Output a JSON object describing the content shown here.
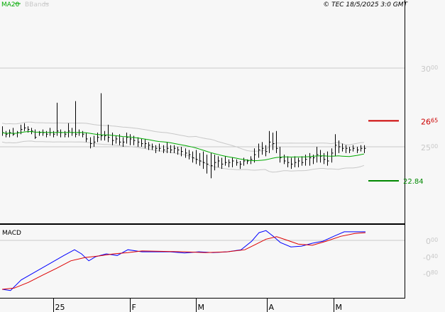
{
  "header": {
    "legend_ma": "MA20",
    "legend_bb": "BBands",
    "copyright": "© TEC 18/5/2025 3:0 GMT"
  },
  "colors": {
    "ma": "#00aa00",
    "bb": "#c8c8c8",
    "macd": "#0000ff",
    "signal": "#dd0000",
    "resistance": "#cc0000",
    "support": "#008800"
  },
  "chart_data": [
    {
      "type": "ohlc",
      "title": "Price",
      "ylim": [
        20.5,
        31.5
      ],
      "yticks": [
        {
          "value": 30,
          "int": "30",
          "dec": "00"
        },
        {
          "value": 25,
          "int": "25",
          "dec": "00"
        }
      ],
      "xticks": [
        {
          "bar": 14,
          "label": "25"
        },
        {
          "bar": 35,
          "label": "F"
        },
        {
          "bar": 53,
          "label": "M"
        },
        {
          "bar": 72.5,
          "label": "A"
        },
        {
          "bar": 90.7,
          "label": "M"
        }
      ],
      "levels": [
        {
          "name": "resistance",
          "value": 26.65,
          "int": "26",
          "dec": "65"
        },
        {
          "name": "support",
          "value": 22.84,
          "label": "22.84"
        }
      ],
      "overlays": [
        "MA20",
        "BBands(20,2)"
      ],
      "bars_hlc": [
        [
          26.3,
          25.7,
          25.9
        ],
        [
          26.0,
          25.6,
          25.8
        ],
        [
          26.1,
          25.6,
          25.9
        ],
        [
          26.2,
          25.7,
          25.8
        ],
        [
          26.0,
          25.6,
          25.9
        ],
        [
          26.4,
          25.8,
          26.1
        ],
        [
          26.5,
          26.0,
          26.2
        ],
        [
          26.3,
          25.9,
          26.1
        ],
        [
          26.2,
          25.8,
          26.0
        ],
        [
          26.1,
          25.5,
          25.6
        ],
        [
          26.0,
          25.7,
          25.9
        ],
        [
          26.1,
          25.7,
          25.9
        ],
        [
          26.0,
          25.6,
          25.8
        ],
        [
          26.2,
          25.7,
          25.9
        ],
        [
          26.0,
          25.6,
          25.8
        ],
        [
          27.8,
          25.7,
          26.0
        ],
        [
          26.1,
          25.6,
          25.9
        ],
        [
          26.0,
          25.6,
          25.8
        ],
        [
          26.5,
          25.6,
          26.0
        ],
        [
          26.2,
          25.7,
          25.9
        ],
        [
          27.9,
          25.6,
          25.8
        ],
        [
          26.1,
          25.7,
          25.9
        ],
        [
          26.0,
          25.6,
          25.8
        ],
        [
          25.9,
          25.3,
          25.5
        ],
        [
          25.6,
          24.9,
          25.2
        ],
        [
          25.7,
          25.0,
          25.3
        ],
        [
          25.9,
          25.3,
          25.6
        ],
        [
          28.4,
          25.4,
          25.7
        ],
        [
          26.0,
          25.4,
          25.7
        ],
        [
          26.4,
          25.3,
          25.6
        ],
        [
          25.9,
          25.1,
          25.4
        ],
        [
          25.7,
          25.2,
          25.5
        ],
        [
          25.8,
          25.1,
          25.3
        ],
        [
          25.6,
          25.0,
          25.3
        ],
        [
          25.9,
          25.2,
          25.6
        ],
        [
          25.8,
          25.1,
          25.5
        ],
        [
          25.7,
          25.1,
          25.4
        ],
        [
          25.6,
          25.0,
          25.3
        ],
        [
          25.5,
          25.0,
          25.2
        ],
        [
          25.5,
          24.9,
          25.2
        ],
        [
          25.3,
          24.8,
          25.1
        ],
        [
          25.2,
          24.8,
          25.0
        ],
        [
          25.1,
          24.6,
          24.9
        ],
        [
          25.2,
          24.7,
          24.9
        ],
        [
          25.1,
          24.6,
          24.8
        ],
        [
          25.3,
          24.6,
          24.9
        ],
        [
          25.1,
          24.6,
          24.8
        ],
        [
          25.1,
          24.6,
          24.9
        ],
        [
          25.0,
          24.5,
          24.8
        ],
        [
          25.0,
          24.4,
          24.7
        ],
        [
          24.9,
          24.3,
          24.6
        ],
        [
          24.8,
          24.2,
          24.5
        ],
        [
          24.7,
          24.0,
          24.3
        ],
        [
          24.8,
          23.9,
          24.2
        ],
        [
          24.6,
          23.8,
          24.1
        ],
        [
          24.7,
          23.6,
          24.0
        ],
        [
          24.5,
          23.3,
          23.9
        ],
        [
          24.6,
          23.0,
          23.8
        ],
        [
          24.5,
          23.5,
          24.0
        ],
        [
          24.4,
          23.7,
          24.1
        ],
        [
          24.3,
          23.6,
          23.9
        ],
        [
          24.4,
          23.8,
          24.0
        ],
        [
          24.2,
          23.7,
          24.0
        ],
        [
          24.3,
          23.7,
          24.1
        ],
        [
          24.2,
          23.8,
          24.0
        ],
        [
          24.1,
          23.6,
          23.9
        ],
        [
          24.3,
          23.8,
          24.1
        ],
        [
          24.2,
          23.9,
          24.1
        ],
        [
          24.4,
          23.9,
          24.2
        ],
        [
          24.9,
          24.0,
          24.5
        ],
        [
          25.2,
          24.3,
          24.8
        ],
        [
          25.3,
          24.5,
          24.9
        ],
        [
          25.1,
          24.4,
          24.7
        ],
        [
          26.0,
          24.6,
          25.3
        ],
        [
          25.9,
          24.8,
          25.2
        ],
        [
          26.0,
          24.6,
          24.9
        ],
        [
          25.0,
          24.0,
          24.3
        ],
        [
          24.5,
          23.9,
          24.1
        ],
        [
          24.4,
          23.7,
          24.0
        ],
        [
          24.3,
          23.6,
          23.9
        ],
        [
          24.4,
          23.7,
          24.0
        ],
        [
          24.3,
          23.7,
          24.1
        ],
        [
          24.4,
          23.8,
          24.0
        ],
        [
          24.5,
          23.8,
          24.2
        ],
        [
          24.6,
          23.8,
          24.3
        ],
        [
          24.5,
          23.9,
          24.3
        ],
        [
          25.0,
          24.0,
          24.5
        ],
        [
          24.8,
          24.0,
          24.4
        ],
        [
          24.6,
          23.9,
          24.2
        ],
        [
          24.7,
          23.8,
          24.1
        ],
        [
          24.9,
          24.0,
          24.6
        ],
        [
          25.8,
          24.4,
          25.1
        ],
        [
          25.4,
          24.6,
          25.0
        ],
        [
          25.2,
          24.7,
          24.9
        ],
        [
          25.1,
          24.6,
          24.9
        ],
        [
          25.0,
          24.6,
          24.8
        ],
        [
          25.1,
          24.7,
          24.9
        ],
        [
          25.0,
          24.6,
          24.8
        ],
        [
          25.1,
          24.7,
          24.9
        ],
        [
          25.1,
          24.6,
          24.9
        ]
      ]
    },
    {
      "type": "line",
      "title": "MACD",
      "ylim": [
        -1.4,
        0.4
      ],
      "yticks": [
        {
          "value": 0,
          "int": "0",
          "dec": "00"
        },
        {
          "value": -0.4,
          "int": "-0",
          "dec": "40"
        },
        {
          "value": -0.8,
          "int": "-0",
          "dec": "80"
        }
      ],
      "series": [
        {
          "name": "MACD",
          "points": [
            [
              0,
              -1.2
            ],
            [
              2.3,
              -1.23
            ],
            [
              5.2,
              -0.97
            ],
            [
              9.1,
              -0.77
            ],
            [
              13,
              -0.57
            ],
            [
              16.9,
              -0.37
            ],
            [
              19.8,
              -0.23
            ],
            [
              21.7,
              -0.33
            ],
            [
              23.7,
              -0.5
            ],
            [
              25.6,
              -0.4
            ],
            [
              28.5,
              -0.33
            ],
            [
              31.5,
              -0.37
            ],
            [
              34.4,
              -0.23
            ],
            [
              38.3,
              -0.28
            ],
            [
              46,
              -0.28
            ],
            [
              49.9,
              -0.31
            ],
            [
              53.8,
              -0.28
            ],
            [
              57.7,
              -0.3
            ],
            [
              61.6,
              -0.28
            ],
            [
              65.4,
              -0.23
            ],
            [
              68.3,
              -0.02
            ],
            [
              70.3,
              0.19
            ],
            [
              72.2,
              0.24
            ],
            [
              74.2,
              0.1
            ],
            [
              76.1,
              -0.05
            ],
            [
              79,
              -0.16
            ],
            [
              81.9,
              -0.14
            ],
            [
              84.9,
              -0.07
            ],
            [
              87.8,
              -0.02
            ],
            [
              90.7,
              0.1
            ],
            [
              93.6,
              0.21
            ],
            [
              99.4,
              0.21
            ]
          ]
        },
        {
          "name": "Signal",
          "points": [
            [
              0,
              -1.2
            ],
            [
              3.3,
              -1.17
            ],
            [
              7.2,
              -1.03
            ],
            [
              11.1,
              -0.85
            ],
            [
              15,
              -0.68
            ],
            [
              18.8,
              -0.5
            ],
            [
              22.7,
              -0.42
            ],
            [
              26.6,
              -0.38
            ],
            [
              30.5,
              -0.33
            ],
            [
              34.4,
              -0.3
            ],
            [
              38.3,
              -0.26
            ],
            [
              49.9,
              -0.28
            ],
            [
              55.7,
              -0.3
            ],
            [
              61.6,
              -0.28
            ],
            [
              66.4,
              -0.23
            ],
            [
              69.3,
              -0.1
            ],
            [
              72.2,
              0.03
            ],
            [
              75.1,
              0.09
            ],
            [
              78.1,
              0
            ],
            [
              81,
              -0.09
            ],
            [
              84.9,
              -0.12
            ],
            [
              88.7,
              -0.02
            ],
            [
              92.6,
              0.1
            ],
            [
              96.5,
              0.17
            ],
            [
              99.4,
              0.19
            ]
          ]
        }
      ]
    }
  ]
}
